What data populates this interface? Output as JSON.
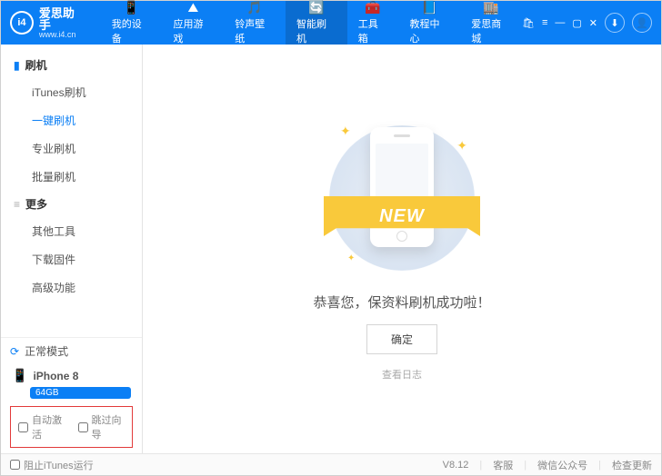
{
  "logo": {
    "badge": "i4",
    "main": "爱思助手",
    "sub": "www.i4.cn"
  },
  "tabs": [
    {
      "label": "我的设备",
      "icon": "📱"
    },
    {
      "label": "应用游戏",
      "icon": "⛰"
    },
    {
      "label": "铃声壁纸",
      "icon": "🎵"
    },
    {
      "label": "智能刷机",
      "icon": "🔄",
      "active": true
    },
    {
      "label": "工具箱",
      "icon": "🧰"
    },
    {
      "label": "教程中心",
      "icon": "📘"
    },
    {
      "label": "爱思商城",
      "icon": "🏬"
    }
  ],
  "sidebar": {
    "g1": {
      "label": "刷机",
      "items": [
        "iTunes刷机",
        "一键刷机",
        "专业刷机",
        "批量刷机"
      ],
      "active": 1
    },
    "g2": {
      "label": "更多",
      "items": [
        "其他工具",
        "下载固件",
        "高级功能"
      ]
    },
    "mode": "正常模式",
    "device": {
      "name": "iPhone 8",
      "storage": "64GB"
    },
    "autoActivate": "自动激活",
    "skipGuide": "跳过向导"
  },
  "main": {
    "message": "恭喜您，保资料刷机成功啦！",
    "button": "确定",
    "viewLog": "查看日志",
    "ribbon": "NEW"
  },
  "status": {
    "block": "阻止iTunes运行",
    "ver": "V8.12",
    "a": "客服",
    "b": "微信公众号",
    "c": "检查更新"
  }
}
